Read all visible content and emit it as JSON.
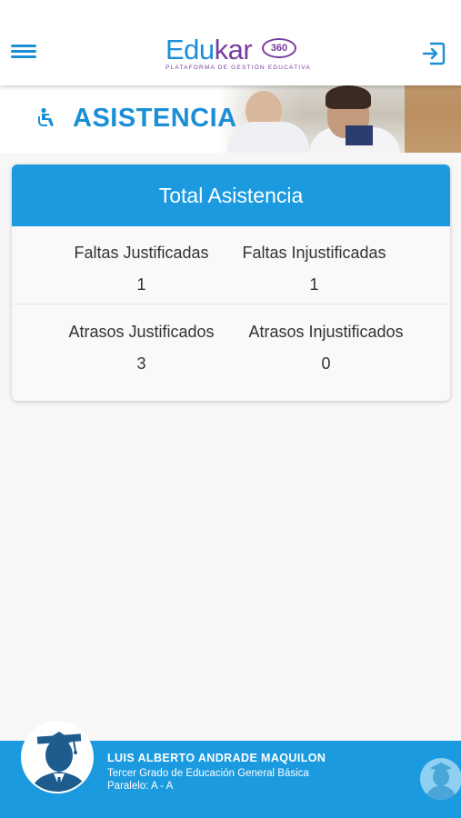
{
  "header": {
    "menu_icon": "hamburger-menu-icon",
    "logo": {
      "part1": "Edu",
      "part2": "kar",
      "badge": "360",
      "tagline": "PLATAFORMA DE GESTIÓN EDUCATIVA"
    },
    "logout_icon": "logout-icon"
  },
  "banner": {
    "icon": "seated-person-icon",
    "title": "ASISTENCIA"
  },
  "card": {
    "title": "Total Asistencia",
    "stats": [
      {
        "label": "Faltas Justificadas",
        "value": "1"
      },
      {
        "label": "Faltas Injustificadas",
        "value": "1"
      },
      {
        "label": "Atrasos Justificados",
        "value": "3"
      },
      {
        "label": "Atrasos Injustificados",
        "value": "0"
      }
    ]
  },
  "footer": {
    "student_name": "LUIS ALBERTO ANDRADE MAQUILON",
    "grade": "Tercer Grado de Educación General Básica",
    "paralelo": "Paralelo: A - A"
  },
  "colors": {
    "primary": "#1b9ae0",
    "brand_blue": "#1b8fd6",
    "brand_purple": "#7a3ba0",
    "background": "#f7f7f7"
  }
}
